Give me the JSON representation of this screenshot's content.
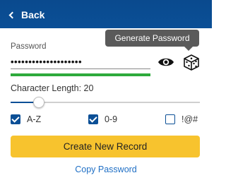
{
  "header": {
    "back_label": "Back",
    "color": "#0b4f96"
  },
  "tooltip": {
    "text": "Generate Password"
  },
  "password": {
    "label": "Password",
    "value": "••••••••••••••••••••",
    "strength_fraction": 1.0,
    "strength_color": "#2eaa3c",
    "show_icon": "eye-icon",
    "generate_icon": "dice-icon"
  },
  "length": {
    "label": "Character Length: 20",
    "value": 20,
    "slider_fraction": 0.15
  },
  "options": [
    {
      "label": "A-Z",
      "checked": true
    },
    {
      "label": "0-9",
      "checked": true
    },
    {
      "label": "!@#",
      "checked": false
    }
  ],
  "actions": {
    "create_label": "Create New Record",
    "create_color": "#f7c32e",
    "copy_label": "Copy Password",
    "link_color": "#1f6fc5"
  }
}
